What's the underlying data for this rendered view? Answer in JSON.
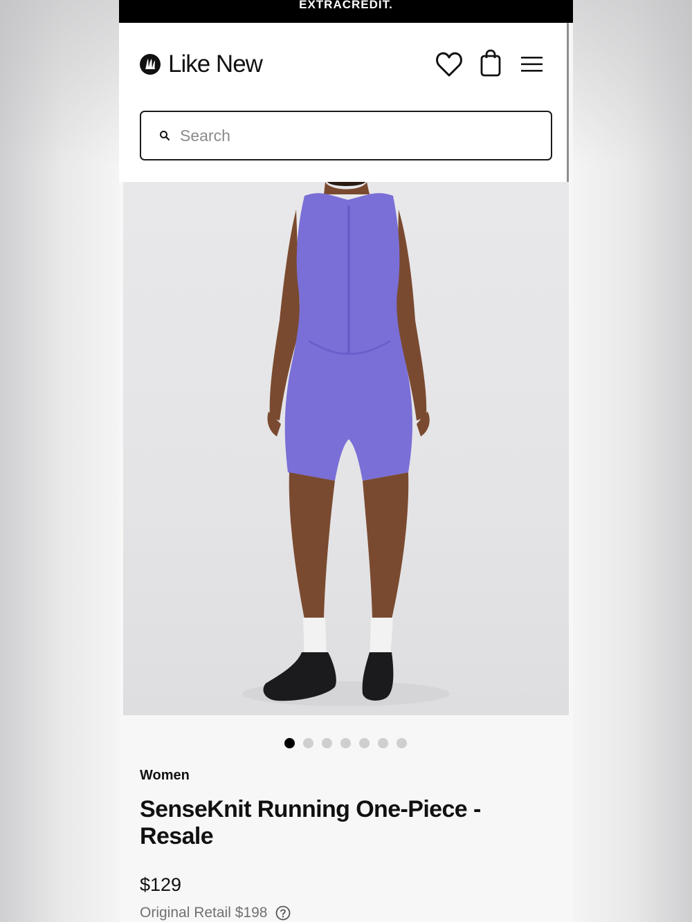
{
  "promo": {
    "text": "EXTRACREDIT."
  },
  "header": {
    "logo_text": "Like New",
    "icons": [
      "lululemon-logo-icon",
      "heart-icon",
      "shopping-bag-icon",
      "menu-icon"
    ]
  },
  "search": {
    "placeholder": "Search",
    "value": ""
  },
  "gallery": {
    "image_alt": "Woman wearing a purple sleeveless running one-piece with black sneakers and white socks",
    "total_images": 7,
    "active_index": 0
  },
  "product": {
    "category": "Women",
    "title": "SenseKnit Running One-Piece - Resale",
    "price": "$129",
    "original_retail": "Original Retail $198"
  },
  "colors": {
    "garment": "#7a6fd6",
    "skin": "#7a4a30",
    "shoe": "#1b1b1d",
    "sock": "#f2f2f2"
  }
}
